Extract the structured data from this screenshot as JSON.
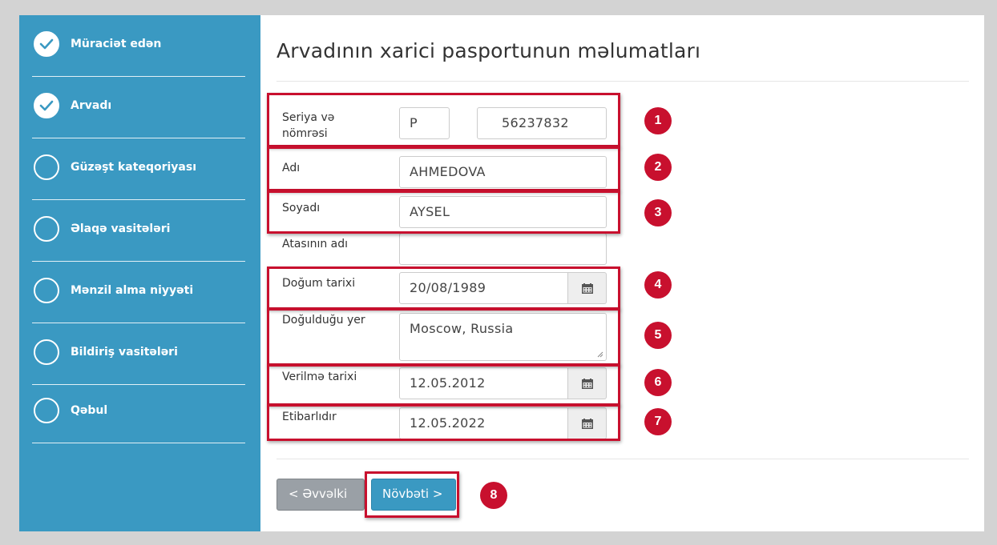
{
  "sidebar": {
    "steps": [
      {
        "label": "Müraciət edən",
        "state": "done"
      },
      {
        "label": "Arvadı",
        "state": "done"
      },
      {
        "label": "Güzəşt kateqoriyası",
        "state": "pending"
      },
      {
        "label": "Əlaqə vasitələri",
        "state": "pending"
      },
      {
        "label": "Mənzil alma niyyəti",
        "state": "pending"
      },
      {
        "label": "Bildiriş vasitələri",
        "state": "pending"
      },
      {
        "label": "Qəbul",
        "state": "pending"
      }
    ]
  },
  "form": {
    "title": "Arvadının xarici pasportunun məlumatları",
    "series_label": "Seriya və nömrəsi",
    "series_value": "P",
    "number_value": "56237832",
    "name_label": "Adı",
    "name_value": "AHMEDOVA",
    "surname_label": "Soyadı",
    "surname_value": "AYSEL",
    "patronymic_label": "Atasının adı",
    "patronymic_value": "",
    "birth_date_label": "Doğum tarixi",
    "birth_date_value": "20/08/1989",
    "birth_place_label": "Doğulduğu yer",
    "birth_place_value": "Moscow, Russia",
    "issue_date_label": "Verilmə tarixi",
    "issue_date_value": "12.05.2012",
    "valid_label": "Etibarlıdır",
    "valid_value": "12.05.2022"
  },
  "buttons": {
    "prev_label": "< Əvvəlki",
    "next_label": "Növbəti >"
  },
  "badges": [
    "1",
    "2",
    "3",
    "4",
    "5",
    "6",
    "7",
    "8"
  ],
  "colors": {
    "sidebar_bg": "#3a99c2",
    "highlight": "#c8102e",
    "prev_button": "#9aa0a6",
    "next_button": "#3a99c2"
  },
  "icons": {
    "done_step": "check-circle-icon",
    "pending_step": "empty-circle-icon",
    "date_picker": "calendar-icon"
  }
}
